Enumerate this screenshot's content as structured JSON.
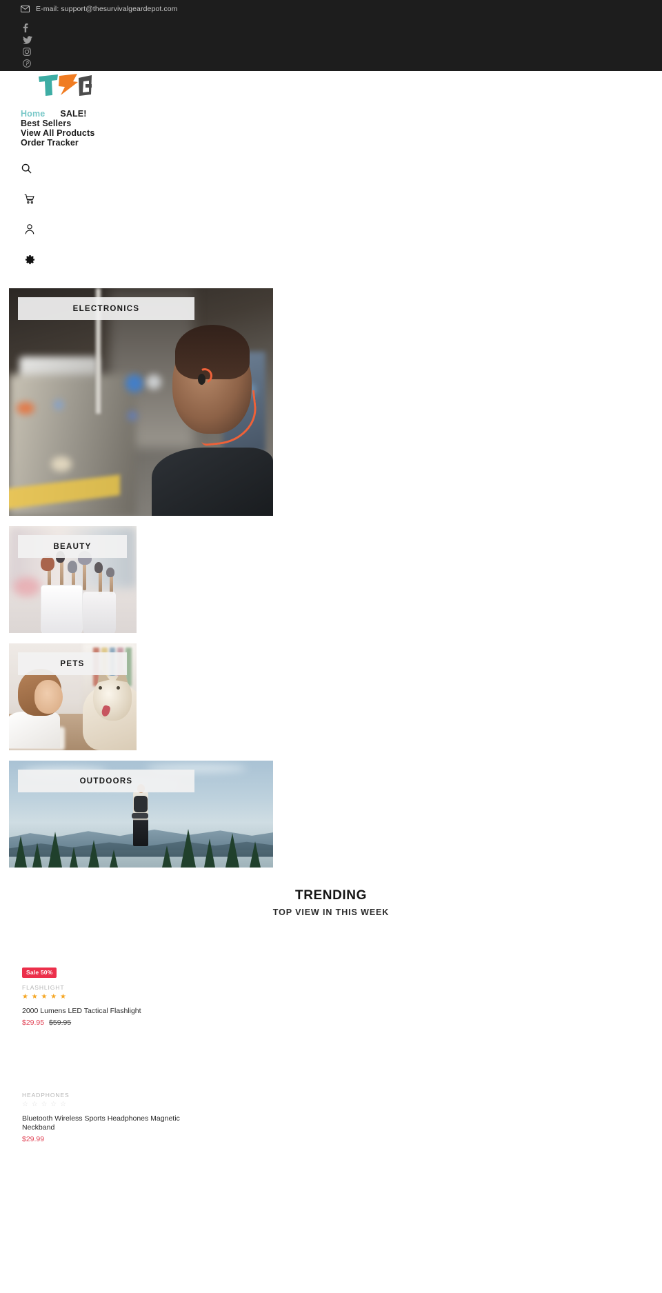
{
  "topbar": {
    "email_icon": "envelope-icon",
    "email_text": "E-mail: support@thesurvivalgeardepot.com",
    "socials": [
      {
        "name": "facebook-icon",
        "label": "Facebook"
      },
      {
        "name": "twitter-icon",
        "label": "Twitter"
      },
      {
        "name": "instagram-icon",
        "label": "Instagram"
      },
      {
        "name": "pinterest-icon",
        "label": "Pinterest"
      }
    ],
    "background": "#1d1d1d"
  },
  "header": {
    "logo": {
      "text": "TSG",
      "letters": [
        {
          "char": "T",
          "color": "#3dada4"
        },
        {
          "char": "S",
          "color": "#f07c22"
        },
        {
          "char": "G",
          "color": "#4c4c4c"
        }
      ]
    },
    "nav": [
      {
        "label": "Home",
        "active": true
      },
      {
        "label": "SALE!",
        "active": false
      },
      {
        "label": "Best Sellers",
        "active": false
      },
      {
        "label": "View All Products",
        "active": false
      },
      {
        "label": "Order Tracker",
        "active": false
      }
    ],
    "active_color": "#78c8c8",
    "icons": [
      {
        "name": "search-icon",
        "label": "Search"
      },
      {
        "name": "cart-icon",
        "label": "Cart"
      },
      {
        "name": "user-icon",
        "label": "Account"
      },
      {
        "name": "gear-icon",
        "label": "Settings"
      }
    ]
  },
  "categories": [
    {
      "label": "ELECTRONICS",
      "size": "large"
    },
    {
      "label": "BEAUTY",
      "size": "small"
    },
    {
      "label": "PETS",
      "size": "small"
    },
    {
      "label": "OUTDOORS",
      "size": "wide"
    }
  ],
  "trending": {
    "title": "TRENDING",
    "subtitle": "TOP VIEW IN THIS WEEK"
  },
  "products": [
    {
      "badge": "Sale 50%",
      "category": "FLASHLIGHT",
      "rating": 5,
      "stars_filled": "★ ★ ★ ★ ★",
      "stars_empty": "",
      "title": "2000 Lumens LED Tactical Flashlight",
      "price": "$29.95",
      "old_price": "$59.95"
    },
    {
      "badge": "",
      "category": "HEADPHONES",
      "rating": 0,
      "stars_filled": "",
      "stars_empty": "☆ ☆ ☆ ☆ ☆",
      "title": "Bluetooth Wireless Sports Headphones Magnetic Neckband",
      "price": "$29.99",
      "old_price": ""
    }
  ],
  "colors": {
    "sale_badge": "#ec2f4b",
    "price": "#e03f52",
    "star_filled": "#f5a623",
    "star_empty": "#dcdcdc",
    "teal": "#78c8c8",
    "orange": "#f07c22"
  }
}
